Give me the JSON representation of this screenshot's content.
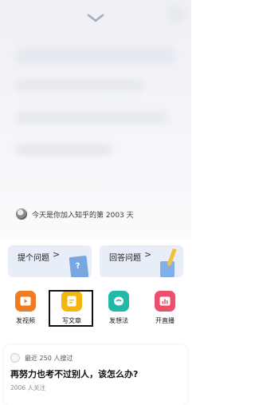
{
  "header": {
    "collapse_icon": "chevron-down-icon"
  },
  "join_info": {
    "text": "今天是你加入知乎的第 2003 天",
    "avatar_icon": "avatar"
  },
  "cards": {
    "ask": {
      "label": "提个问题",
      "arrow": ">",
      "illustration": "book-question-icon"
    },
    "answer": {
      "label": "回答问题",
      "arrow": ">",
      "illustration": "pencil-paper-icon"
    }
  },
  "actions": [
    {
      "label": "发视频",
      "icon": "video-play-icon",
      "color": "#f07b22"
    },
    {
      "label": "写文章",
      "icon": "document-icon",
      "color": "#f5b60b",
      "selected": true
    },
    {
      "label": "发想法",
      "icon": "thought-bubble-icon",
      "color": "#23b9a7"
    },
    {
      "label": "开直播",
      "icon": "live-chart-icon",
      "color": "#ee4d6b"
    }
  ],
  "feed": {
    "recent": "最近 250 人搜过",
    "question": "再努力也考不过别人，该怎么办?",
    "followers": "2006 人关注"
  }
}
